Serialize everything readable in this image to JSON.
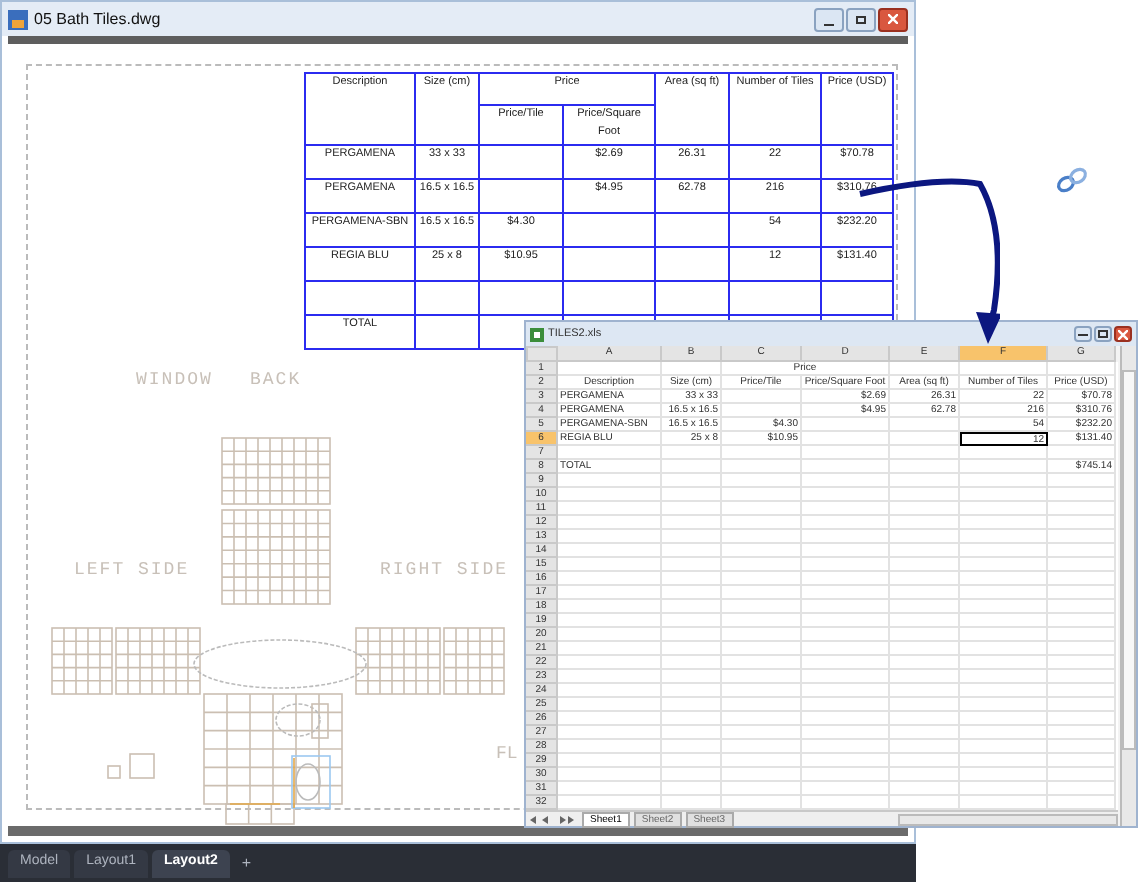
{
  "cad_window": {
    "title": "05 Bath Tiles.dwg",
    "table": {
      "headers": [
        "Description",
        "Size (cm)",
        "Price",
        "Area (sq ft)",
        "Number of Tiles",
        "Price (USD)"
      ],
      "subheaders": [
        "Price/Tile",
        "Price/Square Foot"
      ],
      "rows": [
        {
          "description": "PERGAMENA",
          "size": "33 x 33",
          "price_sqft": "$2.69",
          "area": "26.31",
          "tiles": "22",
          "price_usd": "$70.78"
        },
        {
          "description": "PERGAMENA",
          "size": "16.5 x 16.5",
          "price_sqft": "$4.95",
          "area": "62.78",
          "tiles": "216",
          "price_usd": "$310.76"
        },
        {
          "description": "PERGAMENA-SBN",
          "size": "16.5 x 16.5",
          "price_tile": "$4.30",
          "tiles": "54",
          "price_usd": "$232.20"
        },
        {
          "description": "REGIA BLU",
          "size": "25 x 8",
          "price_tile": "$10.95",
          "tiles": "12",
          "price_usd": "$131.40"
        },
        {},
        {
          "description": "TOTAL"
        }
      ]
    },
    "drawing_labels": [
      "WINDOW",
      "BACK",
      "LEFT SIDE",
      "RIGHT SIDE",
      "FL"
    ],
    "layout_tabs": [
      {
        "label": "Model",
        "selected": false
      },
      {
        "label": "Layout1",
        "selected": false
      },
      {
        "label": "Layout2",
        "selected": true
      }
    ],
    "add_tab": "+"
  },
  "excel_window": {
    "title": "TILES2.xls",
    "columns": [
      {
        "label": "A",
        "selected": false
      },
      {
        "label": "B",
        "selected": false
      },
      {
        "label": "C",
        "selected": false
      },
      {
        "label": "D",
        "selected": false
      },
      {
        "label": "E",
        "selected": false
      },
      {
        "label": "F",
        "selected": true
      },
      {
        "label": "G",
        "selected": false
      }
    ],
    "rows": [
      {
        "number": "1",
        "kind": "title",
        "selected": false,
        "merged_cd": "Price"
      },
      {
        "number": "2",
        "kind": "header",
        "selected": false,
        "cells": {
          "a": "Description",
          "b": "Size (cm)",
          "c": "Price/Tile",
          "d": "Price/Square Foot",
          "e": "Area (sq ft)",
          "f": "Number of Tiles",
          "g": "Price (USD)"
        }
      },
      {
        "number": "3",
        "kind": "data",
        "selected": false,
        "cells": {
          "a": "PERGAMENA",
          "b": "33 x 33",
          "d": "$2.69",
          "e": "26.31",
          "f": "22",
          "g": "$70.78"
        }
      },
      {
        "number": "4",
        "kind": "data",
        "selected": false,
        "cells": {
          "a": "PERGAMENA",
          "b": "16.5 x 16.5",
          "d": "$4.95",
          "e": "62.78",
          "f": "216",
          "g": "$310.76"
        }
      },
      {
        "number": "5",
        "kind": "data",
        "selected": false,
        "cells": {
          "a": "PERGAMENA-SBN",
          "b": "16.5 x 16.5",
          "c": "$4.30",
          "f": "54",
          "g": "$232.20"
        }
      },
      {
        "number": "6",
        "kind": "data",
        "selected": true,
        "cells": {
          "a": "REGIA BLU",
          "b": "25 x 8",
          "c": "$10.95",
          "f": "12",
          "g": "$131.40"
        }
      },
      {
        "number": "7",
        "kind": "data",
        "selected": false
      },
      {
        "number": "8",
        "kind": "data",
        "selected": false,
        "cells": {
          "a": "TOTAL",
          "g": "$745.14"
        }
      },
      {
        "number": "9",
        "kind": "data",
        "selected": false
      },
      {
        "number": "10",
        "kind": "data",
        "selected": false
      },
      {
        "number": "11",
        "kind": "data",
        "selected": false
      },
      {
        "number": "12",
        "kind": "data",
        "selected": false
      },
      {
        "number": "13",
        "kind": "data",
        "selected": false
      },
      {
        "number": "14",
        "kind": "data",
        "selected": false
      },
      {
        "number": "15",
        "kind": "data",
        "selected": false
      },
      {
        "number": "16",
        "kind": "data",
        "selected": false
      },
      {
        "number": "17",
        "kind": "data",
        "selected": false
      },
      {
        "number": "18",
        "kind": "data",
        "selected": false
      },
      {
        "number": "19",
        "kind": "data",
        "selected": false
      },
      {
        "number": "20",
        "kind": "data",
        "selected": false
      },
      {
        "number": "21",
        "kind": "data",
        "selected": false
      },
      {
        "number": "22",
        "kind": "data",
        "selected": false
      },
      {
        "number": "23",
        "kind": "data",
        "selected": false
      },
      {
        "number": "24",
        "kind": "data",
        "selected": false
      },
      {
        "number": "25",
        "kind": "data",
        "selected": false
      },
      {
        "number": "26",
        "kind": "data",
        "selected": false
      },
      {
        "number": "27",
        "kind": "data",
        "selected": false
      },
      {
        "number": "28",
        "kind": "data",
        "selected": false
      },
      {
        "number": "29",
        "kind": "data",
        "selected": false
      },
      {
        "number": "30",
        "kind": "data",
        "selected": false
      },
      {
        "number": "31",
        "kind": "data",
        "selected": false
      },
      {
        "number": "32",
        "kind": "data",
        "selected": false
      }
    ],
    "sheet_tabs": [
      {
        "label": "Sheet1",
        "selected": true
      },
      {
        "label": "Sheet2",
        "selected": false
      },
      {
        "label": "Sheet3",
        "selected": false
      }
    ]
  }
}
